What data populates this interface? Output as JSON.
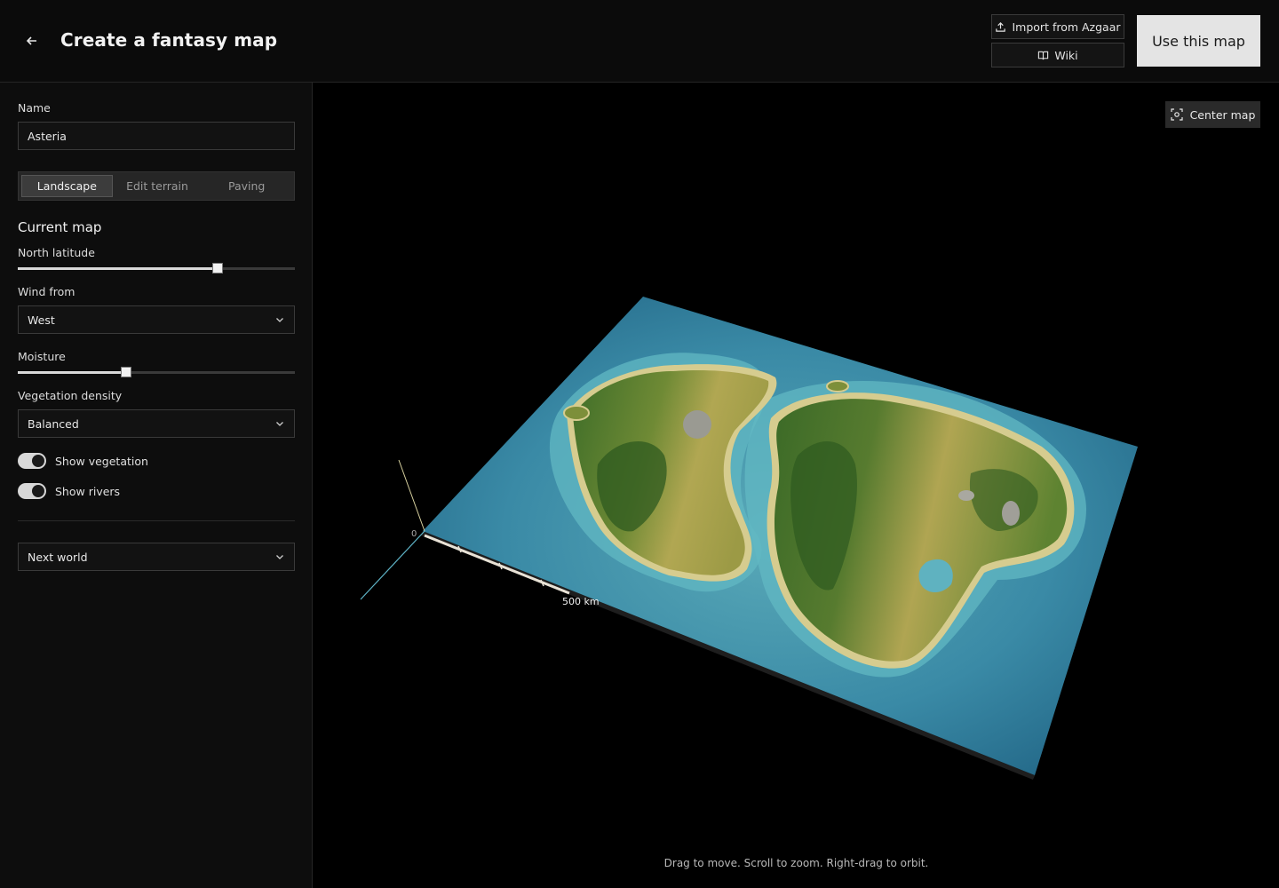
{
  "header": {
    "title": "Create a fantasy map",
    "import_label": "Import from Azgaar",
    "wiki_label": "Wiki",
    "use_label": "Use this map"
  },
  "sidebar": {
    "name_label": "Name",
    "name_value": "Asteria",
    "tabs": [
      {
        "label": "Landscape",
        "active": true
      },
      {
        "label": "Edit terrain",
        "active": false
      },
      {
        "label": "Paving",
        "active": false
      }
    ],
    "section_title": "Current map",
    "north_latitude": {
      "label": "North latitude",
      "value": 0.72
    },
    "wind_from": {
      "label": "Wind from",
      "value": "West"
    },
    "moisture": {
      "label": "Moisture",
      "value": 0.39
    },
    "vegetation_density": {
      "label": "Vegetation density",
      "value": "Balanced"
    },
    "show_vegetation": {
      "label": "Show vegetation",
      "on": true
    },
    "show_rivers": {
      "label": "Show rivers",
      "on": true
    },
    "next_world": {
      "value": "Next world"
    }
  },
  "viewport": {
    "center_label": "Center map",
    "hint": "Drag to move. Scroll to zoom. Right-drag to orbit.",
    "scale_zero": "0",
    "scale_label": "500 km"
  },
  "colors": {
    "ocean": "#2b7b9a",
    "shallow": "#5fb2c0",
    "land_dark": "#3f6f2a",
    "land_light": "#a9a24a",
    "sand": "#d8cf93"
  }
}
